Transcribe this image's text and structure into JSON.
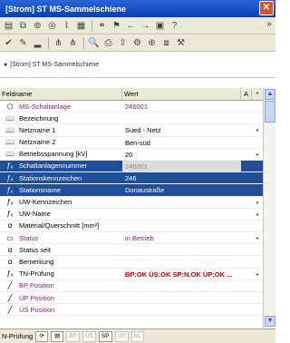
{
  "window": {
    "title": "[Strom] ST MS-Sammelschiene",
    "close_glyph": "✕"
  },
  "toolbar1": {
    "icons": [
      "folder-icon",
      "copy-icon",
      "filter-icon",
      "target-icon",
      "graph-icon",
      "table-icon",
      "binoculars-icon",
      "flag-icon",
      "arrow-left-icon",
      "arrow-right-icon",
      "grid-icon",
      "close-icon",
      "help-icon"
    ],
    "overflow": "»"
  },
  "toolbar2": {
    "icons": [
      "check-icon",
      "pen-icon",
      "chart-icon",
      "tree-icon",
      "tree2-icon",
      "zoom-icon",
      "print-icon",
      "export-icon",
      "settings-icon",
      "zoom-in-icon",
      "window-icon",
      "config-icon"
    ]
  },
  "path": {
    "text": "[Strom] ST MS-Sammelschiene"
  },
  "grid": {
    "headers": {
      "name": "Feldname",
      "value": "Wert",
      "a": "A",
      "star": "*"
    },
    "rows": [
      {
        "icon": "object-icon",
        "glyph": "⬡",
        "name": "MS-Schaltanlage",
        "value": "246001",
        "a": "",
        "star": "",
        "cls": "purple"
      },
      {
        "icon": "book-icon",
        "glyph": "📖",
        "name": "Bezeichnung",
        "value": "",
        "a": "",
        "star": "",
        "cls": ""
      },
      {
        "icon": "book-icon",
        "glyph": "📖",
        "name": "Netzname 1",
        "value": "Sued - Netz",
        "a": "",
        "star": "•",
        "cls": ""
      },
      {
        "icon": "book-icon",
        "glyph": "📖",
        "name": "Netzname 2",
        "value": "Ben-süd",
        "a": "",
        "star": "",
        "cls": ""
      },
      {
        "icon": "book-icon",
        "glyph": "📖",
        "name": "Betriebsspannung [kV]",
        "value": "20",
        "a": "",
        "star": "•",
        "cls": ""
      },
      {
        "icon": "function-icon",
        "glyph": "ƒₓ",
        "name": "Schaltanlagennummer",
        "value": "246001",
        "a": "",
        "star": "•",
        "cls": "sel edit"
      },
      {
        "icon": "function-icon",
        "glyph": "ƒₓ",
        "name": "Stationskennzeichen",
        "value": "246",
        "a": "",
        "star": "•",
        "cls": "sel"
      },
      {
        "icon": "function-icon",
        "glyph": "ƒₓ",
        "name": "Stationsname",
        "value": "Donaustraße",
        "a": "",
        "star": "•",
        "cls": "sel"
      },
      {
        "icon": "function-icon",
        "glyph": "ƒₓ",
        "name": "UW-Kennzeichen",
        "value": "",
        "a": "",
        "star": "•",
        "cls": ""
      },
      {
        "icon": "function-icon",
        "glyph": "ƒₓ",
        "name": "UW-Name",
        "value": "",
        "a": "",
        "star": "•",
        "cls": ""
      },
      {
        "icon": "alpha-icon",
        "glyph": "α",
        "name": "Material/Querschnitt [mm²]",
        "value": "",
        "a": "",
        "star": "",
        "cls": ""
      },
      {
        "icon": "status-icon",
        "glyph": "▭",
        "name": "Status",
        "value": "in Betrieb",
        "a": "",
        "star": "•",
        "cls": "purple"
      },
      {
        "icon": "alpha-icon",
        "glyph": "α",
        "name": "Status seit",
        "value": "",
        "a": "",
        "star": "",
        "cls": ""
      },
      {
        "icon": "alpha-icon",
        "glyph": "α",
        "name": "Bemerkung",
        "value": "",
        "a": "",
        "star": "",
        "cls": ""
      },
      {
        "icon": "function-icon",
        "glyph": "ƒₓ",
        "name": "TN-Prüfung",
        "value": "BP:OK ÜS:OK SP:N.OK ÜP:OK ...",
        "a": "",
        "star": "•",
        "cls": "redval"
      },
      {
        "icon": "line-icon",
        "glyph": "╱",
        "name": "BP Position",
        "value": "",
        "a": "",
        "star": "",
        "cls": "purple"
      },
      {
        "icon": "line-icon",
        "glyph": "╱",
        "name": "ÜP Position",
        "value": "",
        "a": "",
        "star": "",
        "cls": "purple"
      },
      {
        "icon": "line-icon",
        "glyph": "╱",
        "name": "ÜS Position",
        "value": "",
        "a": "",
        "star": "",
        "cls": "purple"
      }
    ]
  },
  "statusbar": {
    "label": "N-Prüfung",
    "buttons": [
      "BP",
      "ÜS",
      "SP",
      "ÜP",
      "NL"
    ],
    "active": [
      "SP"
    ]
  }
}
